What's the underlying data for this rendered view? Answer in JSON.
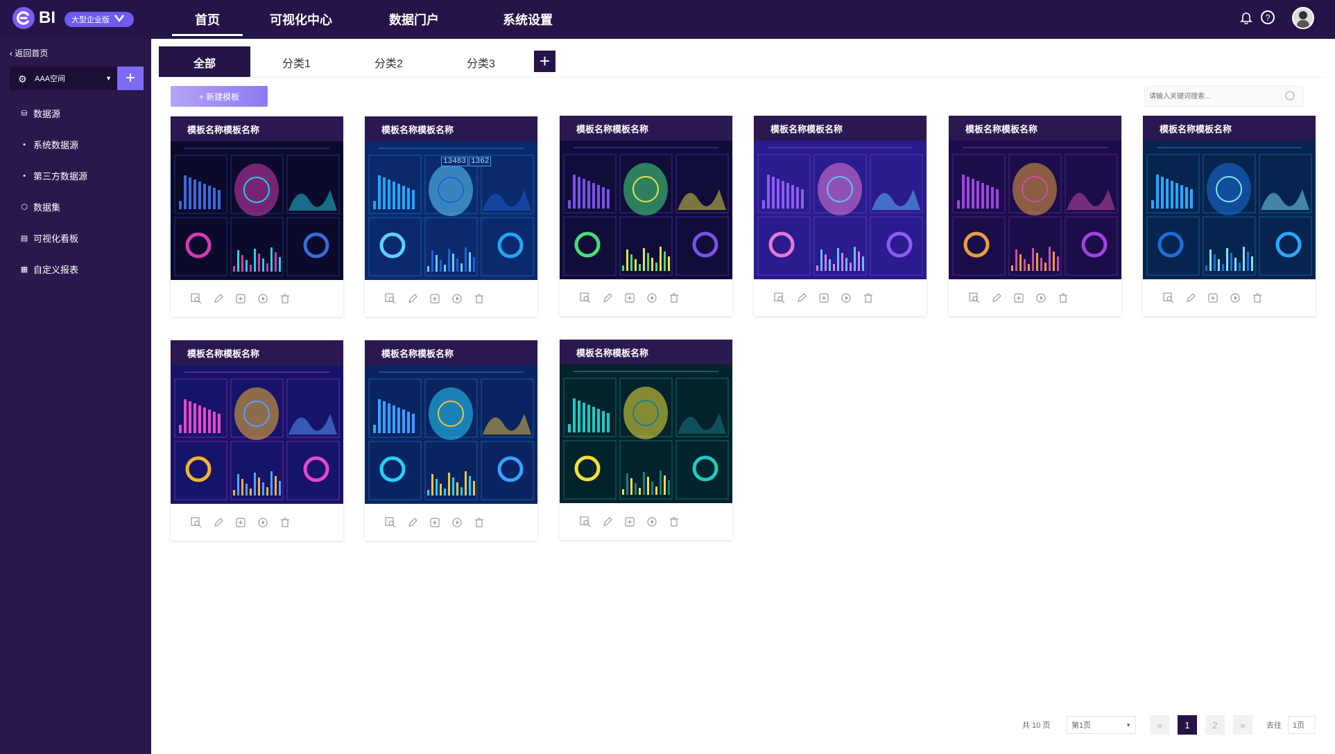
{
  "app": {
    "logo_text": "BI",
    "edition_badge": "大型企业版"
  },
  "nav": {
    "items": [
      {
        "label": "首页",
        "active": true
      },
      {
        "label": "可视化中心",
        "active": false
      },
      {
        "label": "数据门户",
        "active": false
      },
      {
        "label": "系统设置",
        "active": false
      }
    ]
  },
  "sidebar": {
    "back_label": "返回首页",
    "space_label": "AAA空间",
    "items": [
      {
        "label": "数据源",
        "icon": "database-icon"
      },
      {
        "label": "系统数据源",
        "icon": "dot-icon"
      },
      {
        "label": "第三方数据源",
        "icon": "dot-icon"
      },
      {
        "label": "数据集",
        "icon": "cube-icon"
      },
      {
        "label": "可视化看板",
        "icon": "dashboard-icon"
      },
      {
        "label": "自定义报表",
        "icon": "report-icon"
      }
    ]
  },
  "tabs": [
    {
      "label": "全部",
      "active": true
    },
    {
      "label": "分类1",
      "active": false
    },
    {
      "label": "分类2",
      "active": false
    },
    {
      "label": "分类3",
      "active": false
    }
  ],
  "toolbar": {
    "new_template_label": "+ 新建模板",
    "search_placeholder": "请输入关键词搜索..."
  },
  "templates": [
    {
      "title": "模板名称模板名称",
      "style": "dark-map"
    },
    {
      "title": "模板名称模板名称",
      "style": "blue-bars",
      "numbers": [
        "13483",
        "1362"
      ]
    },
    {
      "title": "模板名称模板名称",
      "style": "heatmap"
    },
    {
      "title": "模板名称模板名称",
      "style": "purple-wave"
    },
    {
      "title": "模板名称模板名称",
      "style": "purple-grid"
    },
    {
      "title": "模板名称模板名称",
      "style": "globe"
    },
    {
      "title": "模板名称模板名称",
      "style": "magenta-dash"
    },
    {
      "title": "模板名称模板名称",
      "style": "blue-panels"
    },
    {
      "title": "模板名称模板名称",
      "style": "teal-area"
    }
  ],
  "pagination": {
    "total": "共 10 页",
    "page_select": "第1页",
    "pages": [
      "1",
      "2"
    ],
    "current": "1",
    "prev": "«",
    "next": "»",
    "goto_label": "去往",
    "goto_value": "1页"
  },
  "colors": {
    "primary": "#251447",
    "accent": "#7d6cf3",
    "sidebar": "#2a184d"
  }
}
